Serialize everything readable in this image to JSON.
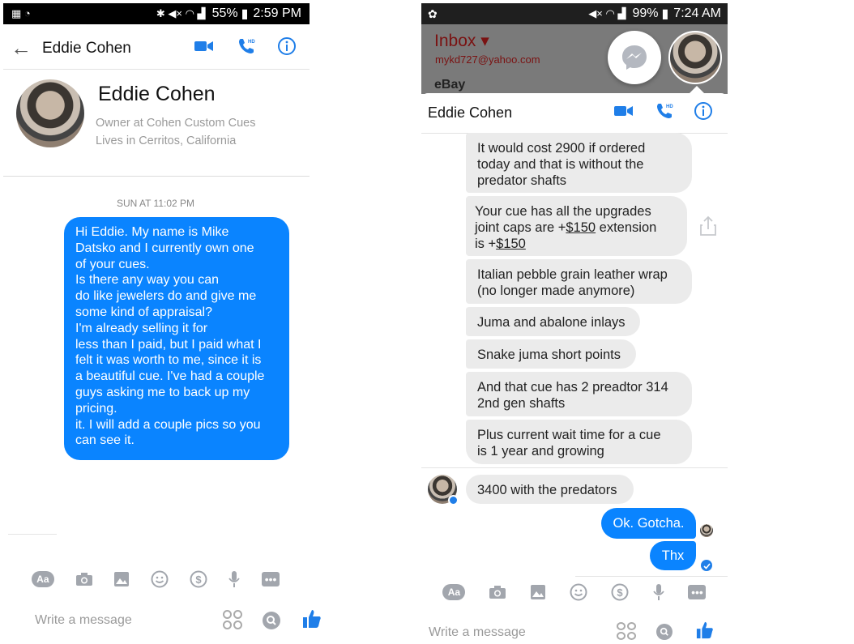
{
  "left": {
    "status": {
      "battery": "55%",
      "time": "2:59 PM"
    },
    "header": {
      "title": "Eddie Cohen"
    },
    "profile": {
      "name": "Eddie Cohen",
      "line1": "Owner at Cohen Custom Cues",
      "line2": "Lives in Cerritos, California"
    },
    "timestamp": "SUN AT 11:02 PM",
    "message_lines": [
      "Hi Eddie. My name is Mike",
      "Datsko and I currently own one",
      "of your cues.",
      "Is there any way you can",
      "do like jewelers do and give me",
      "some kind of appraisal?",
      "I'm already selling it for",
      "less than I paid, but I paid what I",
      "felt it was worth to me, since it is",
      "a beautiful cue. I've had a couple",
      "guys asking me to back up my",
      "pricing.",
      "it. I will add a couple pics so you",
      "can see it."
    ],
    "composer": {
      "aa": "Aa",
      "placeholder": "Write a message"
    }
  },
  "right": {
    "status": {
      "battery": "99%",
      "time": "7:24 AM"
    },
    "behind": {
      "inbox": "Inbox",
      "email": "mykd727@yahoo.com",
      "ebay": "eBay"
    },
    "header": {
      "title": "Eddie Cohen"
    },
    "messages": [
      {
        "lines": [
          "It would cost 2900 if ordered",
          "today and that is without the",
          "predator shafts"
        ]
      },
      {
        "lines": [
          "Your cue has all the upgrades",
          "joint caps are +$150 extension",
          "is +$150"
        ]
      },
      {
        "lines": [
          "Italian pebble grain leather wrap",
          "(no longer made anymore)"
        ]
      },
      {
        "lines": [
          "Juma and abalone inlays"
        ]
      },
      {
        "lines": [
          "Snake juma short points"
        ]
      },
      {
        "lines": [
          "And that cue has 2 preadtor 314",
          "2nd gen shafts"
        ]
      },
      {
        "lines": [
          "Plus current wait time for a cue",
          "is 1 year and growing"
        ]
      },
      {
        "lines": [
          "3400 with the predators"
        ]
      }
    ],
    "sent": [
      "Ok. Gotcha.",
      "Thx"
    ],
    "composer": {
      "aa": "Aa",
      "placeholder": "Write a message"
    }
  },
  "colors": {
    "accent": "#1f7ee8",
    "bubble_out": "#0a84ff",
    "bubble_in": "#ebebeb"
  }
}
